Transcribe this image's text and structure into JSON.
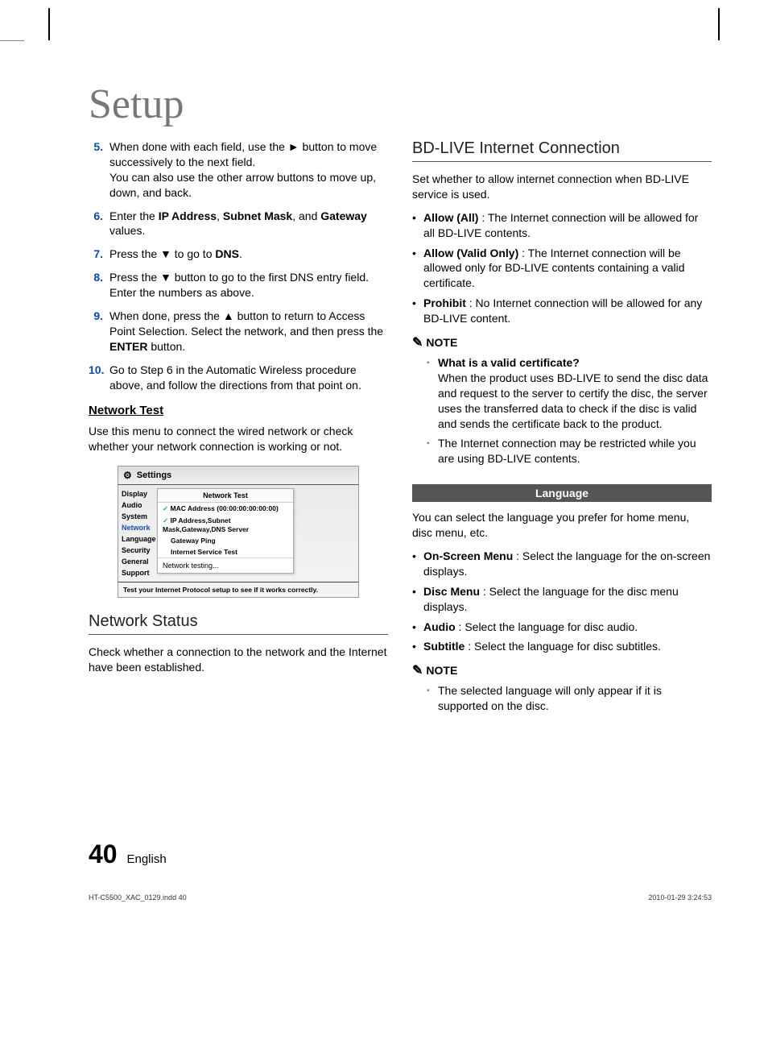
{
  "title": "Setup",
  "leftColumn": {
    "steps": [
      {
        "num": "5.",
        "html": "When done with each field, use the ► button to move successively to the next field.<br>You can also use the other arrow buttons to move up, down, and back."
      },
      {
        "num": "6.",
        "html": "Enter the <span class='b'>IP Address</span>, <span class='b'>Subnet Mask</span>, and <span class='b'>Gateway</span> values."
      },
      {
        "num": "7.",
        "html": "Press the ▼ to go to <span class='b'>DNS</span>."
      },
      {
        "num": "8.",
        "html": "Press the ▼ button to go to the first DNS entry field. Enter the numbers as above."
      },
      {
        "num": "9.",
        "html": "When done, press the ▲ button to return to Access Point Selection. Select the network, and then press the <span class='b'>ENTER</span> button."
      },
      {
        "num": "10.",
        "html": "Go to Step 6 in the Automatic Wireless procedure above, and follow the directions from that point on."
      }
    ],
    "networkTestHeading": "Network Test",
    "networkTestPara": "Use this menu to connect the wired network or check whether your network connection is working or not.",
    "settingsPanel": {
      "title": "Settings",
      "sidebar": [
        "Display",
        "Audio",
        "System",
        "Network",
        "Language",
        "Security",
        "General",
        "Support"
      ],
      "activeIndex": 3,
      "popupTitle": "Network Test",
      "rows": [
        {
          "check": true,
          "label": "MAC Address (00:00:00:00:00:00)"
        },
        {
          "check": true,
          "label": "IP Address,Subnet Mask,Gateway,DNS Server"
        },
        {
          "check": false,
          "label": "Gateway Ping"
        },
        {
          "check": false,
          "label": "Internet Service Test"
        }
      ],
      "testing": "Network testing...",
      "footer": "Test your Internet Protocol setup to see if it works correctly."
    },
    "networkStatusHeading": "Network Status",
    "networkStatusPara": "Check whether a connection to the network and the Internet have been established."
  },
  "rightColumn": {
    "bdLiveHeading": "BD-LIVE Internet Connection",
    "bdLivePara": "Set whether to allow internet connection when BD-LIVE service is used.",
    "bdLiveBullets": [
      {
        "lead": "Allow (All)",
        "text": " : The Internet connection will be allowed for all BD-LIVE contents."
      },
      {
        "lead": "Allow (Valid Only)",
        "text": " : The Internet connection will be allowed only for BD-LIVE contents containing a valid certificate."
      },
      {
        "lead": "Prohibit",
        "text": " : No Internet connection will be allowed for any BD-LIVE content."
      }
    ],
    "noteLabel": "NOTE",
    "bdLiveNotes": [
      {
        "lead": "What is a valid certificate?",
        "text": "When the product uses BD-LIVE to send the disc data and request to the server to certify the disc, the server uses the transferred data to check if the disc is valid and sends the certificate back to the product."
      },
      {
        "lead": "",
        "text": "The Internet connection may be restricted while you are using BD-LIVE contents."
      }
    ],
    "languageBadge": "Language",
    "languagePara": "You can select the language you prefer for home menu, disc menu, etc.",
    "languageBullets": [
      {
        "lead": "On-Screen Menu",
        "text": " : Select the language for the on-screen displays."
      },
      {
        "lead": "Disc Menu",
        "text": " : Select the language for the disc menu displays."
      },
      {
        "lead": "Audio",
        "text": " : Select the language for disc audio."
      },
      {
        "lead": "Subtitle",
        "text": " : Select the language for disc subtitles."
      }
    ],
    "languageNotes": [
      {
        "text": "The selected language will only appear if it is supported on the disc."
      }
    ]
  },
  "footer": {
    "pageNum": "40",
    "lang": "English",
    "printLeft": "HT-C5500_XAC_0129.indd   40",
    "printRight": "2010-01-29   3:24:53"
  }
}
